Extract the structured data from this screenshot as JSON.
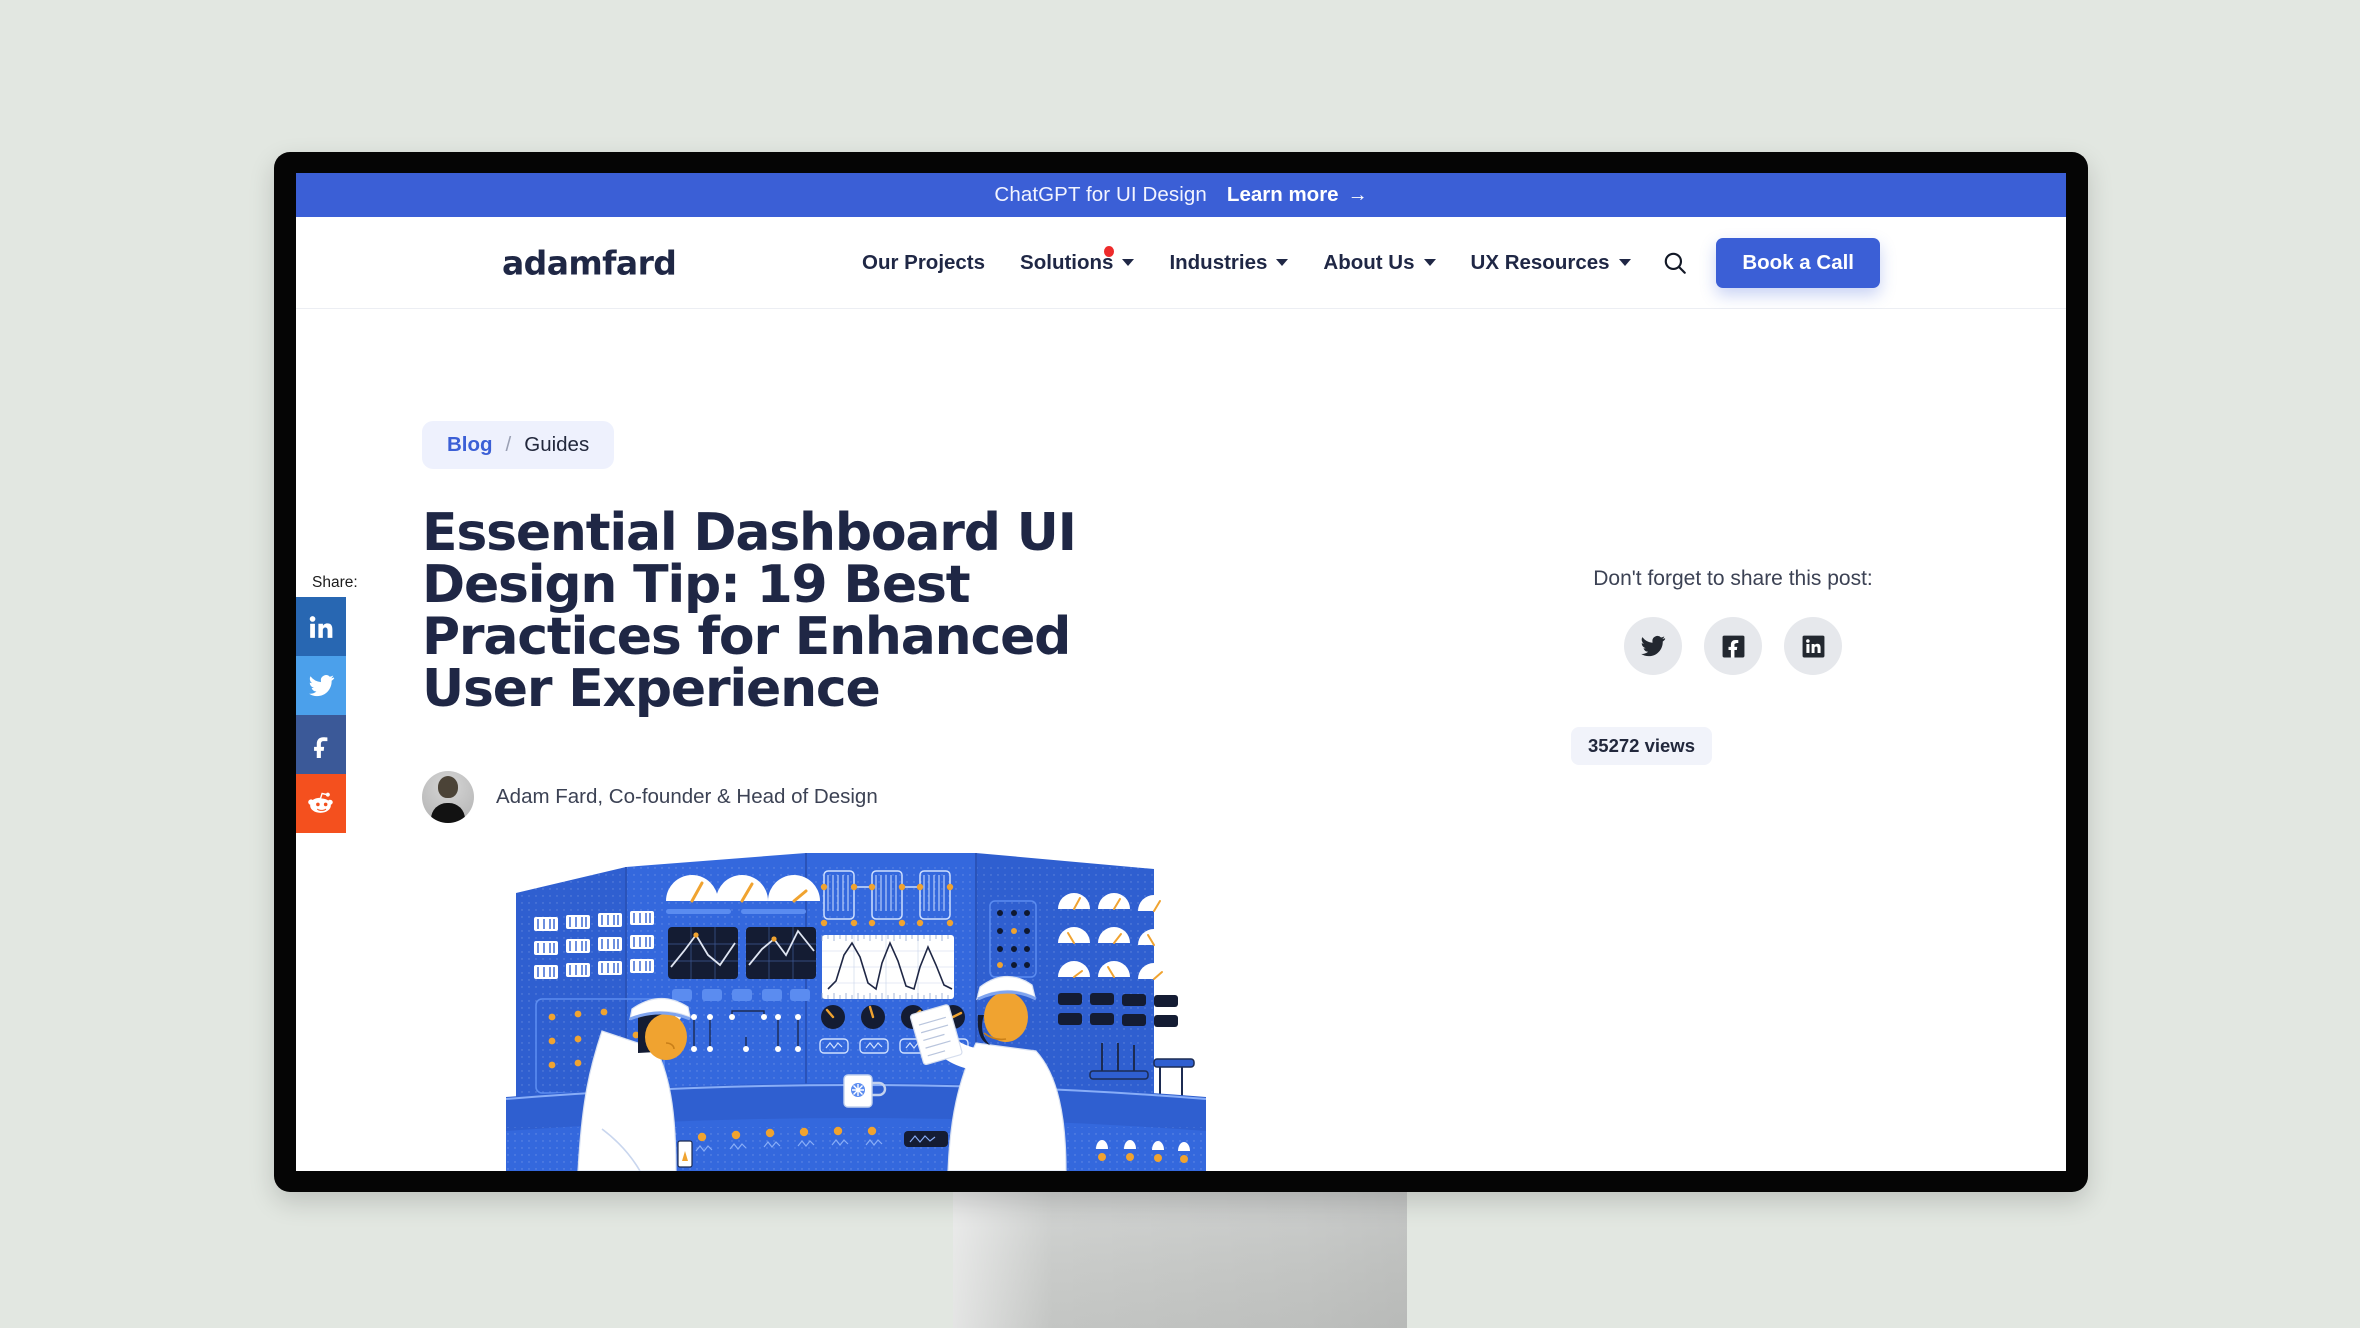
{
  "promo": {
    "text": "ChatGPT for UI Design",
    "link_label": "Learn more",
    "arrow": "→",
    "bg_color": "#3b5fd6"
  },
  "header": {
    "logo": "adamfard",
    "nav": [
      {
        "label": "Our Projects",
        "has_caret": false,
        "has_dot": false
      },
      {
        "label": "Solutions",
        "has_caret": true,
        "has_dot": true
      },
      {
        "label": "Industries",
        "has_caret": true,
        "has_dot": false
      },
      {
        "label": "About Us",
        "has_caret": true,
        "has_dot": false
      },
      {
        "label": "UX Resources",
        "has_caret": true,
        "has_dot": false
      }
    ],
    "search_icon": "search-icon",
    "cta_label": "Book a Call",
    "cta_color": "#3b5fd6"
  },
  "share_rail": {
    "label": "Share:",
    "items": [
      {
        "network": "linkedin",
        "color": "#2867b2"
      },
      {
        "network": "twitter",
        "color": "#4ba0eb"
      },
      {
        "network": "facebook",
        "color": "#3b5998"
      },
      {
        "network": "reddit",
        "color": "#f4501e"
      }
    ]
  },
  "article": {
    "breadcrumb": {
      "home": "Blog",
      "separator": "/",
      "current": "Guides"
    },
    "title": "Essential Dashboard UI Design Tip: 19 Best Practices for Enhanced User Experience",
    "author": "Adam Fard, Co-founder & Head of Design",
    "views_badge": "35272 views"
  },
  "post_share": {
    "title": "Don't forget to share this post:",
    "items": [
      {
        "network": "twitter"
      },
      {
        "network": "facebook"
      },
      {
        "network": "linkedin"
      }
    ]
  },
  "illustration": {
    "name": "control-room-illustration",
    "primary_color": "#2f5fd0",
    "accent_color": "#f0a330"
  }
}
